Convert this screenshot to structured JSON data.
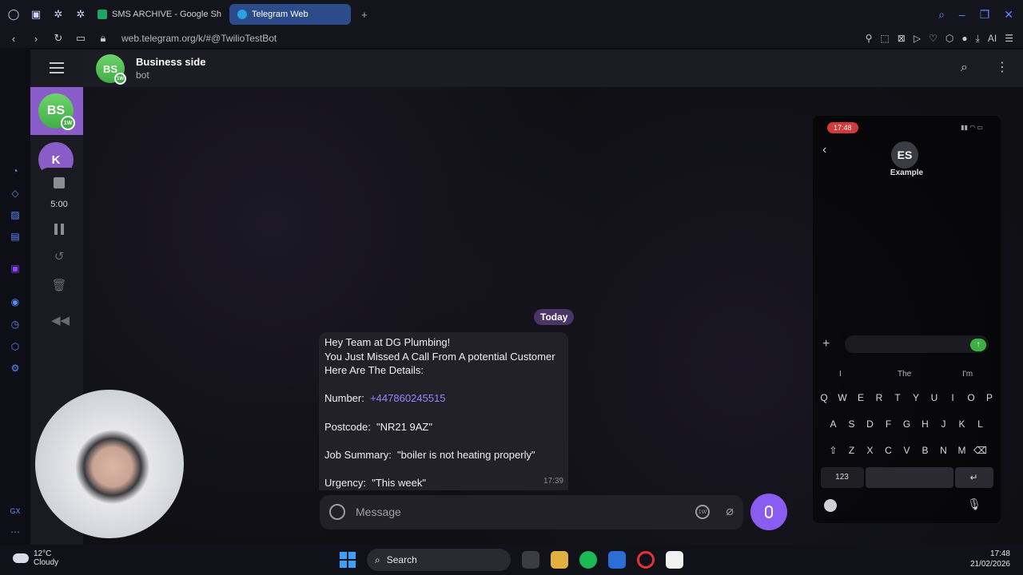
{
  "browser": {
    "tabs": [
      {
        "label": "SMS ARCHIVE - Google Sh",
        "icon": "sheets-icon",
        "color": "#1ea362"
      },
      {
        "label": "Telegram Web",
        "icon": "telegram-icon",
        "color": "#2aa1e0"
      }
    ],
    "url": "web.telegram.org/k/#@TwilioTestBot",
    "ai_label": "AI"
  },
  "telegram": {
    "sidebar_chats": [
      {
        "initials": "BS",
        "badge": "1W"
      },
      {
        "initials": "K"
      }
    ],
    "header": {
      "avatar_initials": "BS",
      "avatar_badge": "1W",
      "title": "Business side",
      "subtitle": "bot"
    },
    "recording": {
      "time": "5:00"
    },
    "date_chip": "Today",
    "message": {
      "lines": [
        "Hey Team at DG Plumbing!",
        "You Just Missed A Call From A potential Customer",
        "Here Are The Details:"
      ],
      "number_label": "Number:",
      "number_value": "+447860245515",
      "postcode": "Postcode:  \"NR21 9AZ\"",
      "job_summary": "Job Summary:  \"boiler is not heating properly\"",
      "urgency": "Urgency:  \"This week\"",
      "time": "17:39"
    },
    "composer": {
      "placeholder": "Message",
      "schedule_badge": "1W"
    }
  },
  "phone": {
    "clock": "17:48",
    "contact_initials": "ES",
    "contact_name": "Example",
    "suggestions": [
      "I",
      "The",
      "I'm"
    ],
    "rows": [
      [
        "Q",
        "W",
        "E",
        "R",
        "T",
        "Y",
        "U",
        "I",
        "O",
        "P"
      ],
      [
        "A",
        "S",
        "D",
        "F",
        "G",
        "H",
        "J",
        "K",
        "L"
      ],
      [
        "Z",
        "X",
        "C",
        "V",
        "B",
        "N",
        "M"
      ]
    ],
    "numbers_key": "123"
  },
  "taskbar": {
    "temp": "12°C",
    "weather": "Cloudy",
    "search_label": "Search",
    "time": "17:48",
    "date": "21/02/2026"
  },
  "colors": {
    "accent": "#8a5cf0",
    "link": "#9a82ff",
    "date_chip": "#4a3566"
  }
}
